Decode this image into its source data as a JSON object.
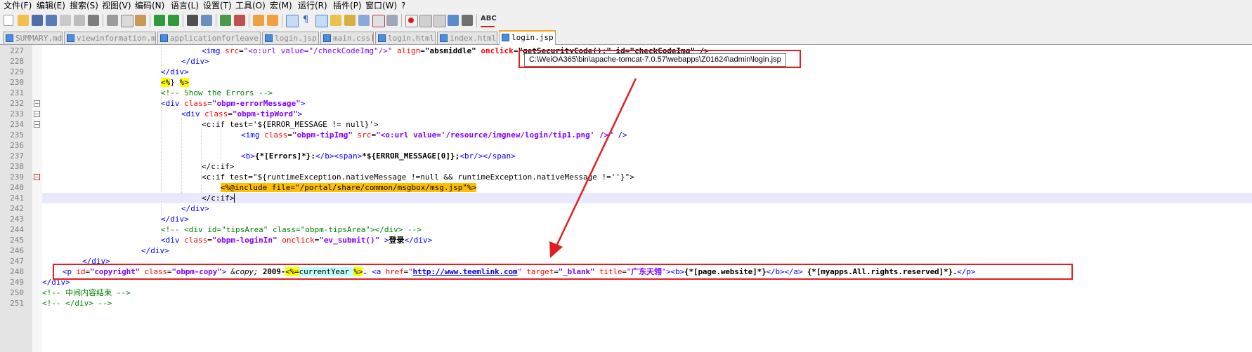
{
  "menu": [
    "文件(F)",
    "编辑(E)",
    "搜索(S)",
    "视图(V)",
    "编码(N)",
    "语言(L)",
    "设置(T)",
    "工具(O)",
    "宏(M)",
    "运行(R)",
    "插件(P)",
    "窗口(W)",
    "?"
  ],
  "toolbar": {
    "spell_label": "ABC"
  },
  "tabs": [
    "SUMMARY.md",
    "viewinformation.md",
    "applicationforleave.md",
    "login.jsp",
    "main.css",
    "login.html",
    "index.html",
    "login.jsp"
  ],
  "tooltip_path": "C:\\WeiOA365\\bin\\apache-tomcat-7.0.57\\webapps\\Z01624\\admin\\login.jsp",
  "line_numbers": [
    "227",
    "228",
    "229",
    "230",
    "231",
    "232",
    "233",
    "234",
    "235",
    "236",
    "237",
    "238",
    "239",
    "240",
    "241",
    "242",
    "243",
    "244",
    "245",
    "246",
    "247",
    "248",
    "249",
    "250",
    "251"
  ],
  "code": {
    "l227": {
      "a": "<img ",
      "b": "src",
      "c": "=",
      "d": "\"<o:url value=\"/checkCodeImg\"/>\"",
      "e": " align",
      "f": "=",
      "g": "\"absmiddle\"",
      "h": " onclick",
      "i": "=",
      "j": "\"getSecurityCode();\" id=\"checkCodeImg\" />"
    },
    "l228": "</div>",
    "l229": "</div>",
    "l230": {
      "a": "<%",
      "b": "} ",
      "c": "%>"
    },
    "l231": "<!-- Show the Errors -->",
    "l232": {
      "a": "<div ",
      "b": "class",
      "c": "=",
      "d": "\"obpm-errorMessage\"",
      "e": ">"
    },
    "l233": {
      "a": "<div ",
      "b": "class",
      "c": "=",
      "d": "\"obpm-tipWord\"",
      "e": ">"
    },
    "l234": "<c:if test='${ERROR_MESSAGE != null}'>",
    "l235": {
      "a": "<img ",
      "b": "class",
      "c": "=",
      "d": "\"obpm-tipImg\"",
      "e": " src",
      "f": "=",
      "g": "\"<o:url value='/resource/imgnew/login/tip1.png' />\"",
      "h": " />"
    },
    "l237": {
      "a": "<b>",
      "b": "{*[Errors]*}:",
      "c": "</b><span>",
      "d": "*${ERROR_MESSAGE[0]};",
      "e": "<br/></span>"
    },
    "l238": "</c:if>",
    "l239": "<c:if test=\"${runtimeException.nativeMessage !=null && runtimeException.nativeMessage !=''}\">",
    "l240": {
      "a": "<%@",
      "b": "include file=\"/portal/share/common/msgbox/msg.jsp\"",
      "c": "%>"
    },
    "l241": "</c:if>",
    "l242": "</div>",
    "l243": "</div>",
    "l244": "<!-- <div id=\"tipsArea\" class=\"obpm-tipsArea\"></div> -->",
    "l245": {
      "a": "<div ",
      "b": "class",
      "c": "=",
      "d": "\"obpm-loginIn\"",
      "e": " onclick",
      "f": "=",
      "g": "\"ev_submit()\"",
      "h": " >",
      "i": "登录",
      "j": "</div>"
    },
    "l246": "</div>",
    "l247": "</div>",
    "l248": {
      "a": "<p ",
      "b": "id",
      "c": "=",
      "d": "\"copyright\"",
      "e": " class",
      "f": "=",
      "g": "\"obpm-copy\"",
      "h": "> ",
      "i": "&copy;",
      "j": " 2009-",
      "k": "<%=",
      "l": "currentYear ",
      "m": "%>",
      "n": ". ",
      "o": "<a ",
      "p": "href",
      "q": "=",
      "r": "\"",
      "s": "http://www.teemlink.com",
      "t": "\"",
      "u": " target",
      "v": "=",
      "w": "\"_blank\"",
      "x": " title",
      "y": "=",
      "z": "\"",
      "aa": "广东天翎",
      "ab": "\"",
      "ac": "><b>",
      "ad": "{*[page.website]*}",
      "ae": "</b></a>",
      "af": " {*[myapps.All.rights.reserved]*}.",
      "ag": "</p>"
    },
    "l249": "</div>",
    "l250": "<!-- 中间内容结束 -->",
    "l251": "<!-- </div> -->"
  }
}
